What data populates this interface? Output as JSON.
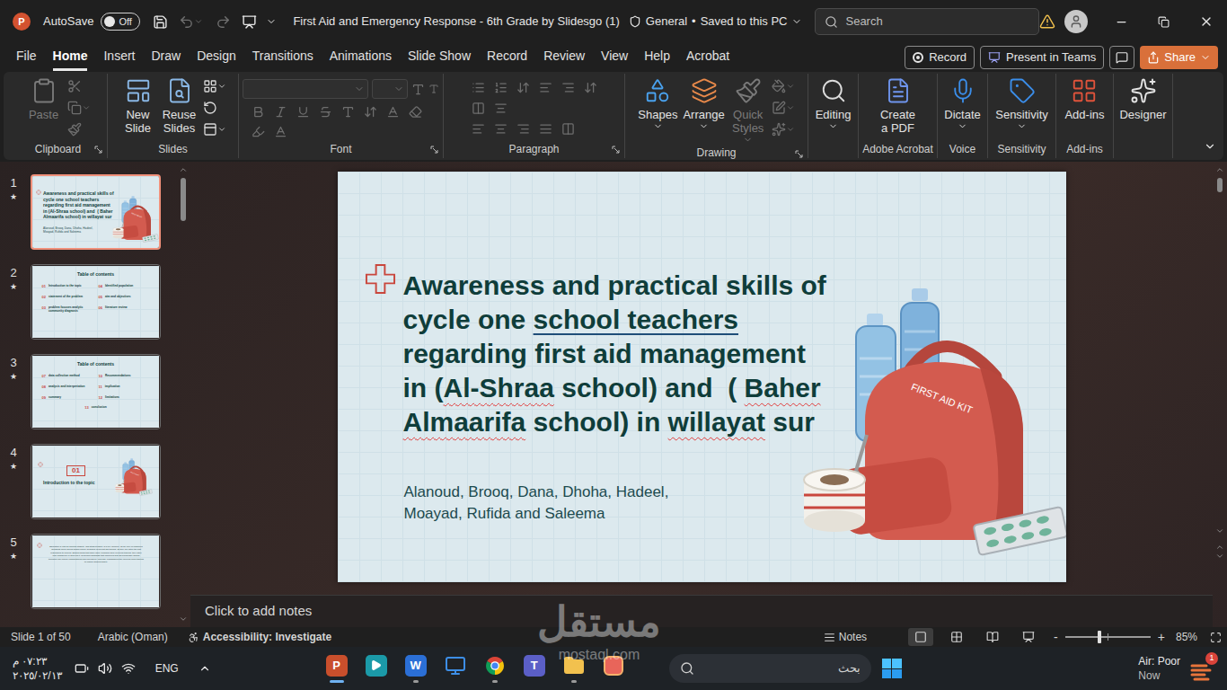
{
  "titlebar": {
    "app_letter": "P",
    "autosave_label": "AutoSave",
    "autosave_state": "Off",
    "autosave_on": false,
    "undo_enabled": false,
    "redo_enabled": false,
    "document_title": "First Aid and Emergency Response - 6th Grade by Slidesgo (1)",
    "sensitivity": "General",
    "separator": "•",
    "save_status": "Saved to this PC",
    "search_placeholder": "Search"
  },
  "menu": {
    "tabs": [
      {
        "label": "File",
        "selected": false
      },
      {
        "label": "Home",
        "selected": true
      },
      {
        "label": "Insert",
        "selected": false
      },
      {
        "label": "Draw",
        "selected": false
      },
      {
        "label": "Design",
        "selected": false
      },
      {
        "label": "Transitions",
        "selected": false
      },
      {
        "label": "Animations",
        "selected": false
      },
      {
        "label": "Slide Show",
        "selected": false
      },
      {
        "label": "Record",
        "selected": false
      },
      {
        "label": "Review",
        "selected": false
      },
      {
        "label": "View",
        "selected": false
      },
      {
        "label": "Help",
        "selected": false
      },
      {
        "label": "Acrobat",
        "selected": false
      }
    ],
    "record_button": "Record",
    "teams_button": "Present in Teams",
    "share_button": "Share"
  },
  "ribbon": {
    "groups": [
      {
        "kind": "clipboard",
        "label": "Clipboard",
        "launcher": true,
        "small_disabled": true,
        "buttons": [
          {
            "lines": [
              "Paste"
            ],
            "disabled": true,
            "dropdown": false
          }
        ]
      },
      {
        "kind": "slides",
        "label": "Slides",
        "launcher": false,
        "small_disabled": false,
        "buttons": [
          {
            "lines": [
              "New",
              "Slide"
            ],
            "disabled": false,
            "dropdown": false
          },
          {
            "lines": [
              "Reuse",
              "Slides"
            ],
            "disabled": false,
            "dropdown": false
          }
        ]
      },
      {
        "kind": "font",
        "label": "Font",
        "launcher": true,
        "small_disabled": true,
        "buttons": []
      },
      {
        "kind": "paragraph",
        "label": "Paragraph",
        "launcher": true,
        "small_disabled": true,
        "buttons": []
      },
      {
        "kind": "drawing",
        "label": "Drawing",
        "launcher": true,
        "small_disabled": true,
        "buttons": [
          {
            "lines": [
              "Shapes"
            ],
            "disabled": false,
            "dropdown": true
          },
          {
            "lines": [
              "Arrange"
            ],
            "disabled": false,
            "dropdown": true
          },
          {
            "lines": [
              "Quick",
              "Styles"
            ],
            "disabled": true,
            "dropdown": true
          }
        ]
      },
      {
        "kind": "editing",
        "label": "",
        "launcher": false,
        "buttons": [
          {
            "lines": [
              "Editing"
            ],
            "disabled": false,
            "dropdown": true
          }
        ]
      },
      {
        "kind": "acrobat",
        "label": "Adobe Acrobat",
        "launcher": false,
        "buttons": [
          {
            "lines": [
              "Create",
              "a PDF"
            ],
            "disabled": false,
            "dropdown": false
          }
        ]
      },
      {
        "kind": "voice",
        "label": "Voice",
        "launcher": false,
        "buttons": [
          {
            "lines": [
              "Dictate"
            ],
            "disabled": false,
            "dropdown": true
          }
        ]
      },
      {
        "kind": "sensitivity",
        "label": "Sensitivity",
        "launcher": false,
        "buttons": [
          {
            "lines": [
              "Sensitivity"
            ],
            "disabled": false,
            "dropdown": true
          }
        ]
      },
      {
        "kind": "addins",
        "label": "Add-ins",
        "launcher": false,
        "buttons": [
          {
            "lines": [
              "Add-ins"
            ],
            "disabled": false,
            "dropdown": false
          }
        ]
      },
      {
        "kind": "designer",
        "label": "",
        "launcher": false,
        "buttons": [
          {
            "lines": [
              "Designer"
            ],
            "disabled": false,
            "dropdown": false
          }
        ]
      }
    ]
  },
  "thumbnails": [
    {
      "number": "1",
      "mark": "★",
      "selected": true,
      "kind": "title"
    },
    {
      "number": "2",
      "mark": "★",
      "selected": false,
      "kind": "toc",
      "heading": "Table of contents",
      "items": [
        {
          "num": "01",
          "text": "Introduction to the topic"
        },
        {
          "num": "02",
          "text": "statement of the problem"
        },
        {
          "num": "03",
          "text": "problem focuses analytic community diagnosis"
        },
        {
          "num": "04",
          "text": "Identified population"
        },
        {
          "num": "05",
          "text": "aim and objectives"
        },
        {
          "num": "06",
          "text": "literature review"
        }
      ]
    },
    {
      "number": "3",
      "mark": "★",
      "selected": false,
      "kind": "toc",
      "heading": "Table of contents",
      "items": [
        {
          "num": "07",
          "text": "data collection method"
        },
        {
          "num": "08",
          "text": "analysis and interpretation"
        },
        {
          "num": "09",
          "text": "summary"
        },
        {
          "num": "10",
          "text": "Recommendations"
        },
        {
          "num": "11",
          "text": "implication"
        },
        {
          "num": "12",
          "text": "limitations"
        },
        {
          "num": "13",
          "text": "conclusion"
        }
      ]
    },
    {
      "number": "4",
      "mark": "★",
      "selected": false,
      "kind": "section",
      "section_number": "01",
      "section_title": "Introduction to the topic"
    },
    {
      "number": "5",
      "mark": "★",
      "selected": false,
      "kind": "text",
      "body": "Education is vital for societal stability, and student safety is a key concern, as 50-60% of children's accidents occur during school hours. Teachers need first aid training, as they are often the first responders to injuries. Studies show that while many teachers have received training, they often lack confidence in applying it. Research highlights that improving first aid knowledge among teachers can reduce complications and emergency referrals, emphasizing the need for such training to ensure student safety."
    }
  ],
  "slide": {
    "title_lines": [
      [
        {
          "text": "Awareness and practical skills of",
          "style": "plain"
        }
      ],
      [
        {
          "text": "cycle one ",
          "style": "plain"
        },
        {
          "text": "school teachers",
          "style": "link"
        }
      ],
      [
        {
          "text": "regarding first aid management",
          "style": "plain"
        }
      ],
      [
        {
          "text": "in (",
          "style": "plain"
        },
        {
          "text": "Al-Shraa",
          "style": "misspelled"
        },
        {
          "text": " school) and  ( ",
          "style": "plain"
        },
        {
          "text": "Baher",
          "style": "misspelled"
        }
      ],
      [
        {
          "text": "Almaarifa",
          "style": "misspelled"
        },
        {
          "text": " school) in ",
          "style": "plain"
        },
        {
          "text": "willayat",
          "style": "misspelled"
        },
        {
          "text": " sur",
          "style": "plain"
        }
      ]
    ],
    "author_lines": [
      "Alanoud, Brooq, Dana, Dhoha, Hadeel,",
      "Moayad, Rufida and Saleema"
    ],
    "kit_label": "FIRST AID KIT"
  },
  "notes_placeholder": "Click to add notes",
  "status_bar": {
    "slide_info": "Slide 1 of 50",
    "language": "Arabic (Oman)",
    "accessibility": "Accessibility: Investigate",
    "notes": "Notes",
    "views": [
      {
        "selected": true
      },
      {
        "selected": false
      },
      {
        "selected": false
      },
      {
        "selected": false
      }
    ],
    "zoom_out": "-",
    "zoom_in": "+",
    "zoom_level": 0.4,
    "zoom": "85%"
  },
  "taskbar": {
    "time": "٠٧:٢٣ م",
    "date": "٢٠٢٥/٠٢/١٣",
    "language": "ENG",
    "search_placeholder": "بحث",
    "weather_title": "Air: Poor",
    "weather_sub": "Now",
    "weather_badge": "1",
    "apps": [
      {
        "kind": "letter",
        "glyph": "P",
        "color": "#c94f2c",
        "running": true,
        "active": true
      },
      {
        "kind": "play",
        "color": "#1b9aa8",
        "running": false,
        "active": false
      },
      {
        "kind": "letter",
        "glyph": "W",
        "color": "#2b6fd6",
        "running": true,
        "active": false
      },
      {
        "kind": "monitor",
        "color": "#3d8ee6",
        "running": false,
        "active": false
      },
      {
        "kind": "chrome",
        "color": "#db4437",
        "running": true,
        "active": false
      },
      {
        "kind": "letter",
        "glyph": "T",
        "color": "#5b5fc7",
        "running": false,
        "active": false
      },
      {
        "kind": "folder",
        "color": "#f2c14e",
        "running": true,
        "active": false
      },
      {
        "kind": "gallery",
        "color": "#e8655a",
        "running": false,
        "active": false
      }
    ]
  },
  "watermark": {
    "arabic": "مستقل",
    "latin": "mostaql.com"
  }
}
